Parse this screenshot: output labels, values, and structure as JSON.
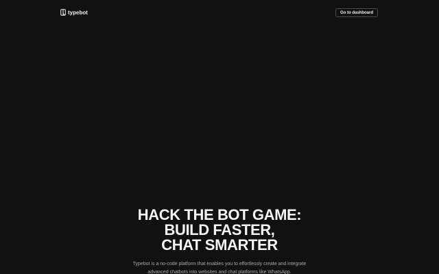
{
  "header": {
    "brand_name": "typebot",
    "dashboard_label": "Go to dashboard",
    "brand_icon": "typebot-logo-icon"
  },
  "hero": {
    "title_line1": "HACK THE BOT GAME:",
    "title_line2": "BUILD FASTER,",
    "title_line3": "CHAT SMARTER",
    "subtitle": "Typebot is a no-code platform that enables you to effortlessly create and integrate advanced chatbots into websites and chat platforms like WhatsApp."
  },
  "colors": {
    "background": "#111111",
    "text": "#f5f5f5",
    "muted_text": "#a9a9a9",
    "button_border": "#4a4a4a"
  }
}
